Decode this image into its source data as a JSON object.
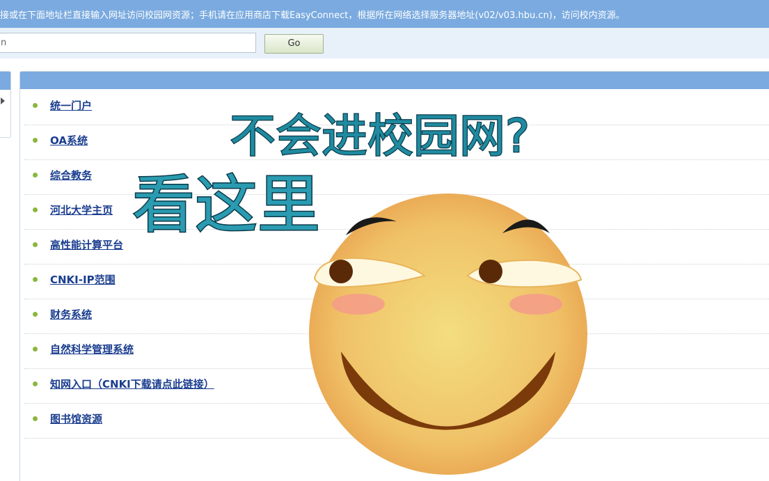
{
  "notice": {
    "text": "接或在下面地址栏直接输入网址访问校园网资源；手机请在应用商店下载EasyConnect，根据所在网络选择服务器地址(v02/v03.hbu.cn)，访问校内资源。"
  },
  "url_bar": {
    "input_value": "n",
    "go_label": "Go"
  },
  "links": [
    {
      "label": "统一门户"
    },
    {
      "label": "OA系统"
    },
    {
      "label": "综合教务"
    },
    {
      "label": "河北大学主页"
    },
    {
      "label": "高性能计算平台"
    },
    {
      "label": "CNKI-IP范围"
    },
    {
      "label": "财务系统"
    },
    {
      "label": "自然科学管理系统"
    },
    {
      "label": "知网入口（CNKI下载请点此链接）"
    },
    {
      "label": "图书馆资源"
    }
  ],
  "overlay": {
    "title": "不会进校园网?",
    "subtitle": "看这里"
  },
  "colors": {
    "header_blue": "#7aaadf",
    "link_blue": "#1a3d8f",
    "bullet_green": "#8ab63f",
    "overlay_teal": "#1f8ba0",
    "emoji_yellow": "#f2c468"
  },
  "icons": {
    "bullet": "green-dot-icon",
    "emoji": "smirk-face-emoji",
    "left_arrow": "triangle-right-icon"
  }
}
